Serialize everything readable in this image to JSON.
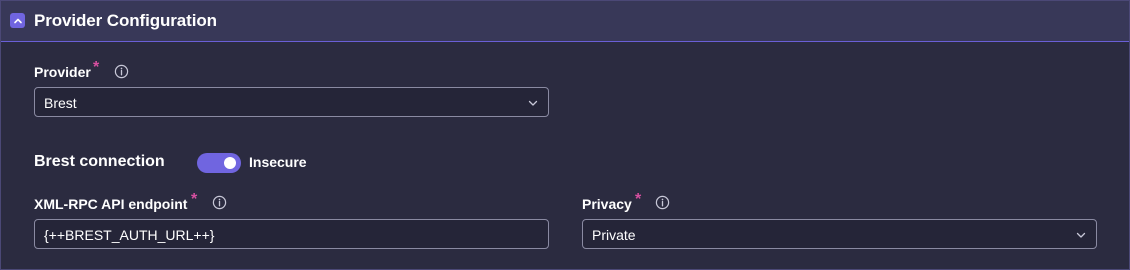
{
  "panel": {
    "title": "Provider Configuration",
    "colors": {
      "accent": "#7065e0",
      "required": "#d64fa0"
    }
  },
  "provider": {
    "label": "Provider",
    "required_mark": "*",
    "value": "Brest"
  },
  "connection": {
    "title": "Brest connection",
    "toggle_label": "Insecure",
    "toggle_on": true
  },
  "endpoint": {
    "label": "XML-RPC API endpoint",
    "required_mark": "*",
    "value": "{++BREST_AUTH_URL++}"
  },
  "privacy": {
    "label": "Privacy",
    "required_mark": "*",
    "value": "Private"
  },
  "icons": {
    "collapse": "chevron-up-icon",
    "info": "info-icon",
    "dropdown": "chevron-down-icon"
  }
}
